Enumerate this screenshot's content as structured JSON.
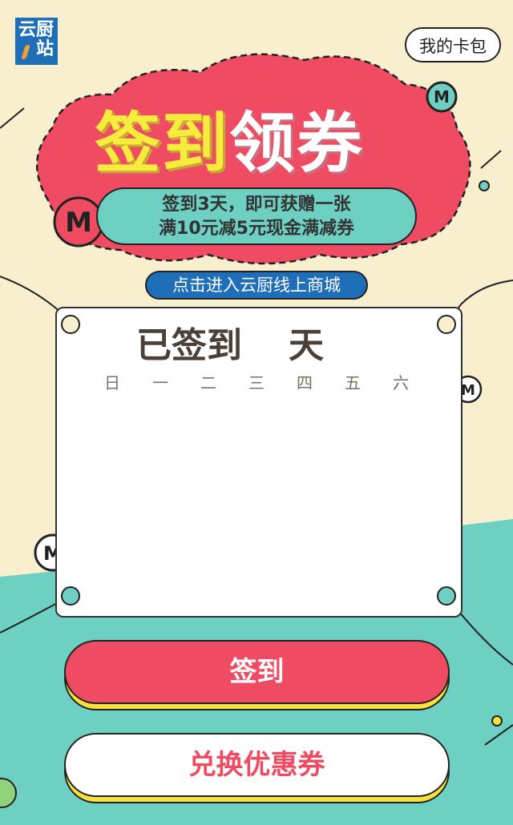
{
  "header": {
    "logo_line1": "云",
    "logo_line2": "站",
    "logo_mid": "厨",
    "wallet_label": "我的卡包"
  },
  "banner": {
    "title_part1": "签到",
    "title_part2": "领券",
    "promo_line1": "签到3天，即可获赠一张",
    "promo_line2": "满10元减5元现金满减券",
    "mall_link": "点击进入云厨线上商城",
    "badge_letter": "M"
  },
  "checkin_card": {
    "signed_prefix": "已签到",
    "signed_suffix": "天",
    "weekdays": [
      "日",
      "一",
      "二",
      "三",
      "四",
      "五",
      "六"
    ]
  },
  "buttons": {
    "checkin": "签到",
    "redeem": "兑换优惠券"
  },
  "colors": {
    "background": "#f8efcf",
    "cloud": "#ef4b63",
    "teal": "#6dd0c2",
    "brand_blue": "#1f6fb8",
    "yellow": "#f7e13a"
  }
}
